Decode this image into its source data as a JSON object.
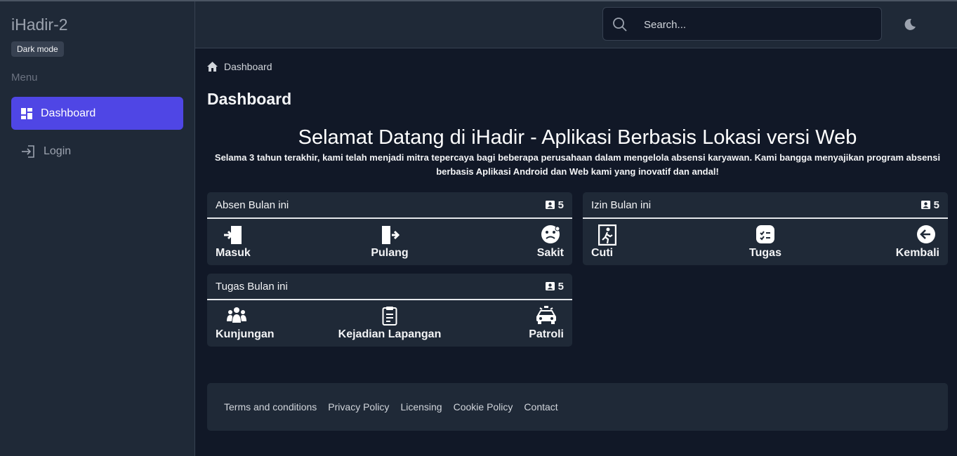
{
  "sidebar": {
    "app_title": "iHadir-2",
    "dark_mode_label": "Dark mode",
    "menu_label": "Menu",
    "items": [
      {
        "label": "Dashboard",
        "icon": "dashboard-grid-icon",
        "active": true
      },
      {
        "label": "Login",
        "icon": "login-icon",
        "active": false
      }
    ]
  },
  "header": {
    "search_placeholder": "Search...",
    "theme_icon": "moon-icon"
  },
  "breadcrumb": {
    "label": "Dashboard",
    "icon": "home-icon"
  },
  "page_title": "Dashboard",
  "welcome": {
    "title": "Selamat Datang di iHadir - Aplikasi Berbasis Lokasi versi Web",
    "description": "Selama 3 tahun terakhir, kami telah menjadi mitra tepercaya bagi beberapa perusahaan dalam mengelola absensi karyawan. Kami bangga menyajikan program absensi berbasis Aplikasi Android dan Web kami yang inovatif dan andal!"
  },
  "cards": {
    "absen": {
      "title": "Absen Bulan ini",
      "count": "5",
      "items": [
        {
          "label": "Masuk",
          "icon": "door-enter-icon"
        },
        {
          "label": "Pulang",
          "icon": "door-exit-icon"
        },
        {
          "label": "Sakit",
          "icon": "sick-face-icon"
        }
      ]
    },
    "izin": {
      "title": "Izin Bulan ini",
      "count": "5",
      "items": [
        {
          "label": "Cuti",
          "icon": "walking-exit-icon"
        },
        {
          "label": "Tugas",
          "icon": "checklist-icon"
        },
        {
          "label": "Kembali",
          "icon": "arrow-left-circle-icon"
        }
      ]
    },
    "tugas": {
      "title": "Tugas Bulan ini",
      "count": "5",
      "items": [
        {
          "label": "Kunjungan",
          "icon": "people-group-icon"
        },
        {
          "label": "Kejadian Lapangan",
          "icon": "clipboard-icon"
        },
        {
          "label": "Patroli",
          "icon": "patrol-car-icon"
        }
      ]
    }
  },
  "footer": {
    "links": [
      "Terms and conditions",
      "Privacy Policy",
      "Licensing",
      "Cookie Policy",
      "Contact"
    ]
  },
  "colors": {
    "accent": "#4f46e5",
    "background": "#111827",
    "panel": "#1f2937"
  }
}
